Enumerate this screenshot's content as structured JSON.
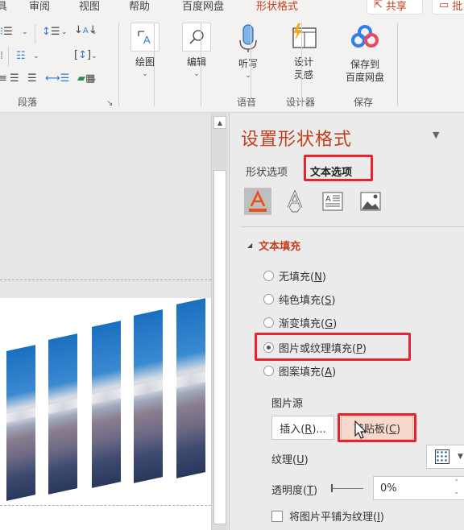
{
  "tabs": [
    {
      "label": "审阅",
      "active": false
    },
    {
      "label": "视图",
      "active": false
    },
    {
      "label": "帮助",
      "active": false
    },
    {
      "label": "百度网盘",
      "active": false
    },
    {
      "label": "形状格式",
      "active": true
    }
  ],
  "tab_partial_left": "具",
  "share_button": {
    "label": "共享",
    "icon": "share-icon"
  },
  "comment_button": {
    "label": "批",
    "icon": "comment-icon"
  },
  "ribbon": {
    "paragraph_group": {
      "label": "段落",
      "icons": [
        "numbered-list-icon",
        "line-spacing-icon",
        "text-direction-icon",
        "columns-icon",
        "align-text-icon",
        "align-center-icon",
        "align-right-icon",
        "justify-icon",
        "distributed-icon",
        "smartart-convert-icon"
      ]
    },
    "draw": {
      "label": "绘图",
      "icon": "draw-icon"
    },
    "edit": {
      "label": "编辑",
      "icon": "search-icon"
    },
    "dictate": {
      "label": "听写",
      "icon": "microphone-icon",
      "group_label": "语音"
    },
    "designer": {
      "label_line1": "设计",
      "label_line2": "灵感",
      "icon": "designer-icon",
      "group_label": "设计器"
    },
    "save_baidu": {
      "label_line1": "保存到",
      "label_line2": "百度网盘",
      "icon": "baidu-cloud-icon",
      "group_label": "保存"
    }
  },
  "pane": {
    "title": "设置形状格式",
    "tabs": [
      {
        "label": "形状选项",
        "active": false
      },
      {
        "label": "文本选项",
        "active": true
      }
    ],
    "icon_tabs": [
      "text-fill-outline-icon",
      "text-effects-icon",
      "textbox-icon",
      "picture-icon"
    ],
    "section": "文本填充",
    "fill_options": [
      {
        "text": "无填充(",
        "key": "N",
        "checked": false
      },
      {
        "text": "纯色填充(",
        "key": "S",
        "checked": false
      },
      {
        "text": "渐变填充(",
        "key": "G",
        "checked": false
      },
      {
        "text": "图片或纹理填充(",
        "key": "P",
        "checked": true
      },
      {
        "text": "图案填充(",
        "key": "A",
        "checked": false
      }
    ],
    "picture_source_label": "图片源",
    "insert_button": {
      "text": "插入(",
      "key": "R",
      "suffix": ")..."
    },
    "clipboard_button": {
      "text": "剪贴板(",
      "key": "C",
      "suffix": ")"
    },
    "texture_label": {
      "text": "纹理(",
      "key": "U",
      "suffix": ")"
    },
    "transparency_label": {
      "text": "透明度(",
      "key": "T",
      "suffix": ")"
    },
    "transparency_value": "0%",
    "transparency_percent": 0,
    "tile_checkbox": {
      "text": "将图片平铺为纹理(",
      "key": "I",
      "suffix": ")",
      "checked": false
    }
  },
  "colors": {
    "accent": "#c43e1c",
    "highlight_box": "#e8222e",
    "text_fill_orange": "#e8501e"
  }
}
